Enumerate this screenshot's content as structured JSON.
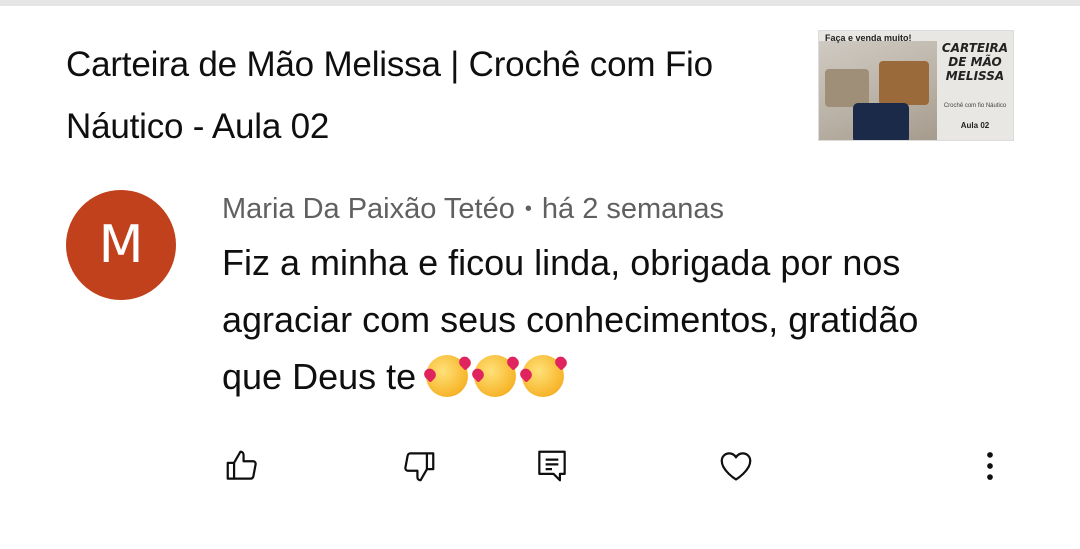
{
  "video": {
    "title": "Carteira de Mão Melissa | Crochê com Fio Náutico - Aula 02",
    "thumbnail": {
      "promo_text": "Faça e venda muito!",
      "headline": "CARTEIRA\nDE MÃO\nMELISSA",
      "subtitle": "Crochê com fio Náutico",
      "lesson": "Aula 02"
    }
  },
  "comment": {
    "avatar_letter": "M",
    "avatar_color": "#c1411c",
    "author": "Maria Da Paixão Tetéo",
    "separator": "•",
    "time_ago": "há 2 semanas",
    "text": "Fiz a minha e ficou linda, obrigada por nos agraciar com seus conhecimentos, gratidão que Deus te",
    "emojis": [
      "smiling-face-with-hearts",
      "smiling-face-with-hearts",
      "smiling-face-with-hearts"
    ]
  },
  "actions": {
    "like_icon": "thumbs-up-icon",
    "dislike_icon": "thumbs-down-icon",
    "reply_icon": "reply-comment-icon",
    "heart_icon": "heart-icon",
    "more_icon": "more-vertical-icon"
  }
}
